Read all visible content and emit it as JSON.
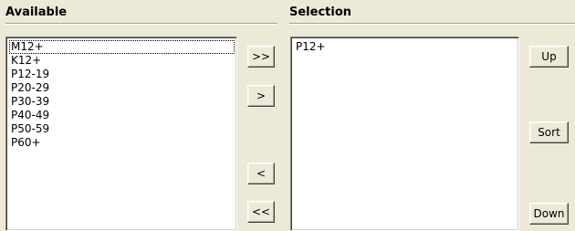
{
  "available": {
    "title": "Available",
    "items": [
      "M12+",
      "K12+",
      "P12-19",
      "P20-29",
      "P30-39",
      "P40-49",
      "P50-59",
      "P60+"
    ]
  },
  "selection": {
    "title": "Selection",
    "items": [
      "P12+"
    ]
  },
  "transfer_buttons": {
    "add_all": ">>",
    "add": ">",
    "remove": "<",
    "remove_all": "<<"
  },
  "order_buttons": {
    "up": "Up",
    "sort": "Sort",
    "down": "Down"
  },
  "colors": {
    "window_bg": "#ece9d8",
    "list_bg": "#ffffff"
  }
}
